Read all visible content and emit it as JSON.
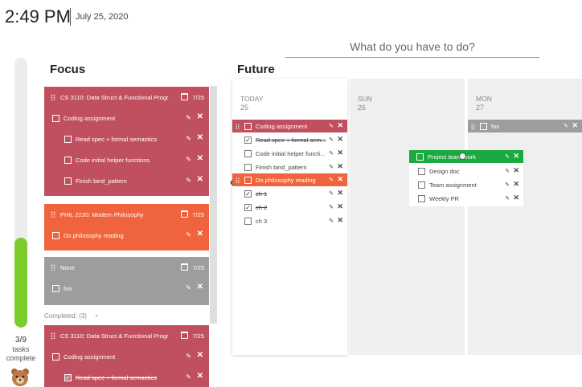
{
  "header": {
    "time": "2:49 PM",
    "date": "July 25, 2020",
    "input_placeholder": "What do you have to do?"
  },
  "progress": {
    "completed": 3,
    "total": 9,
    "fraction": 0.333,
    "count_label": "3/9",
    "label_line1": "tasks",
    "label_line2": "complete",
    "fill_color": "#7ccc2c"
  },
  "focus": {
    "title": "Focus",
    "cards": [
      {
        "title": "CS 3110: Data Struct & Functional Progr",
        "count": "7/25",
        "color": "#c0505f",
        "tasks": [
          {
            "label": "Coding assignment",
            "checked": false,
            "indent": 0
          },
          {
            "label": "Read spec + formal semantics",
            "checked": false,
            "indent": 1
          },
          {
            "label": "Code initial helper functions",
            "checked": false,
            "indent": 1
          },
          {
            "label": "Finish bind_pattern",
            "checked": false,
            "indent": 1
          }
        ]
      },
      {
        "title": "PHIL 2220: Modern Philosophy",
        "count": "7/25",
        "color": "#ef643c",
        "tasks": [
          {
            "label": "Do philosophy reading",
            "checked": false,
            "indent": 0
          }
        ]
      },
      {
        "title": "None",
        "count": "7/25",
        "color": "#9d9d9d",
        "tasks": [
          {
            "label": "foo",
            "checked": false,
            "indent": 0
          }
        ]
      }
    ],
    "completed_label": "Completed: (3)",
    "completed_cards": [
      {
        "title": "CS 3110: Data Struct & Functional Progr",
        "count": "7/25",
        "tasks": [
          {
            "label": "Coding assignment",
            "checked": false
          },
          {
            "label": "Read spec + formal semantics",
            "checked": true
          }
        ]
      }
    ]
  },
  "future": {
    "title": "Future",
    "columns": [
      {
        "day": "TODAY",
        "num": "25",
        "groups": [
          {
            "title": "Coding assignment",
            "color": "#c0505f",
            "tasks": [
              {
                "label": "Read spec + formal sem...",
                "checked": true
              },
              {
                "label": "Code initial helper functi...",
                "checked": false
              },
              {
                "label": "Finish bind_pattern",
                "checked": false
              }
            ]
          },
          {
            "title": "Do philosophy reading",
            "color": "#ef643c",
            "tasks": [
              {
                "label": "ch 1",
                "checked": true
              },
              {
                "label": "ch 2",
                "checked": true
              },
              {
                "label": "ch 3",
                "checked": false
              }
            ]
          }
        ]
      },
      {
        "day": "SUN",
        "num": "26",
        "groups": []
      },
      {
        "day": "MON",
        "num": "27",
        "groups": [
          {
            "title": "foo",
            "color": "#9d9d9d",
            "tasks": []
          }
        ]
      }
    ],
    "dragging": {
      "title": "Project team work",
      "color": "#1aaa3f",
      "tasks": [
        {
          "label": "Design doc",
          "checked": false
        },
        {
          "label": "Team assignment",
          "checked": false
        },
        {
          "label": "Weekly PR",
          "checked": false
        }
      ]
    }
  },
  "icons": {
    "pin": "pin-icon",
    "close": "close-icon",
    "calendar": "calendar-icon",
    "drag": "drag-handle-icon",
    "mascot": "bear-icon"
  }
}
